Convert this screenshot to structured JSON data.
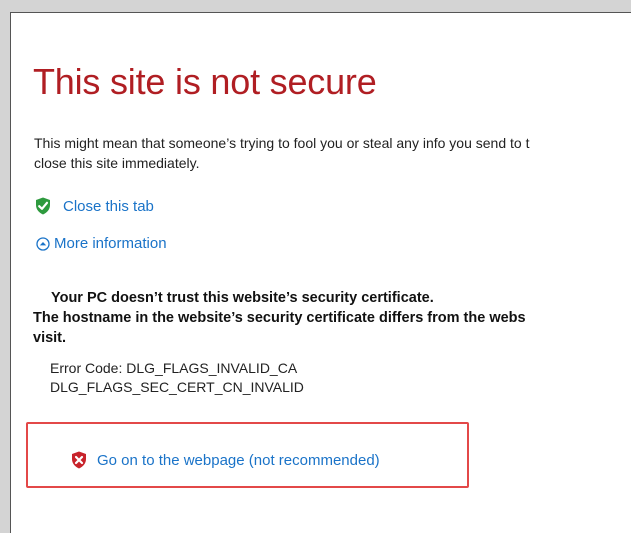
{
  "title": "This site is not secure",
  "description": {
    "line1": "This might mean that someone’s trying to fool you or steal any info you send to t",
    "line2": "close this site immediately."
  },
  "actions": {
    "close_tab": {
      "label": "Close this tab",
      "icon": "green-shield-check-icon"
    },
    "more_info": {
      "label": "More information",
      "icon": "circle-chevron-up-icon"
    },
    "go_on": {
      "label": "Go on to the webpage (not recommended)",
      "icon": "red-shield-x-icon"
    }
  },
  "details": {
    "trust_line1": "Your PC doesn’t trust this website’s security certificate.",
    "trust_line2": "The hostname in the website’s security certificate differs from the webs",
    "trust_line3": "visit.",
    "error_code": "Error Code: DLG_FLAGS_INVALID_CA",
    "error_code2": "DLG_FLAGS_SEC_CERT_CN_INVALID"
  },
  "colors": {
    "title": "#b01e23",
    "link": "#1a73c8",
    "highlight_border": "#e34848",
    "safe_shield": "#2e9a3e",
    "danger_shield": "#c8232b"
  }
}
